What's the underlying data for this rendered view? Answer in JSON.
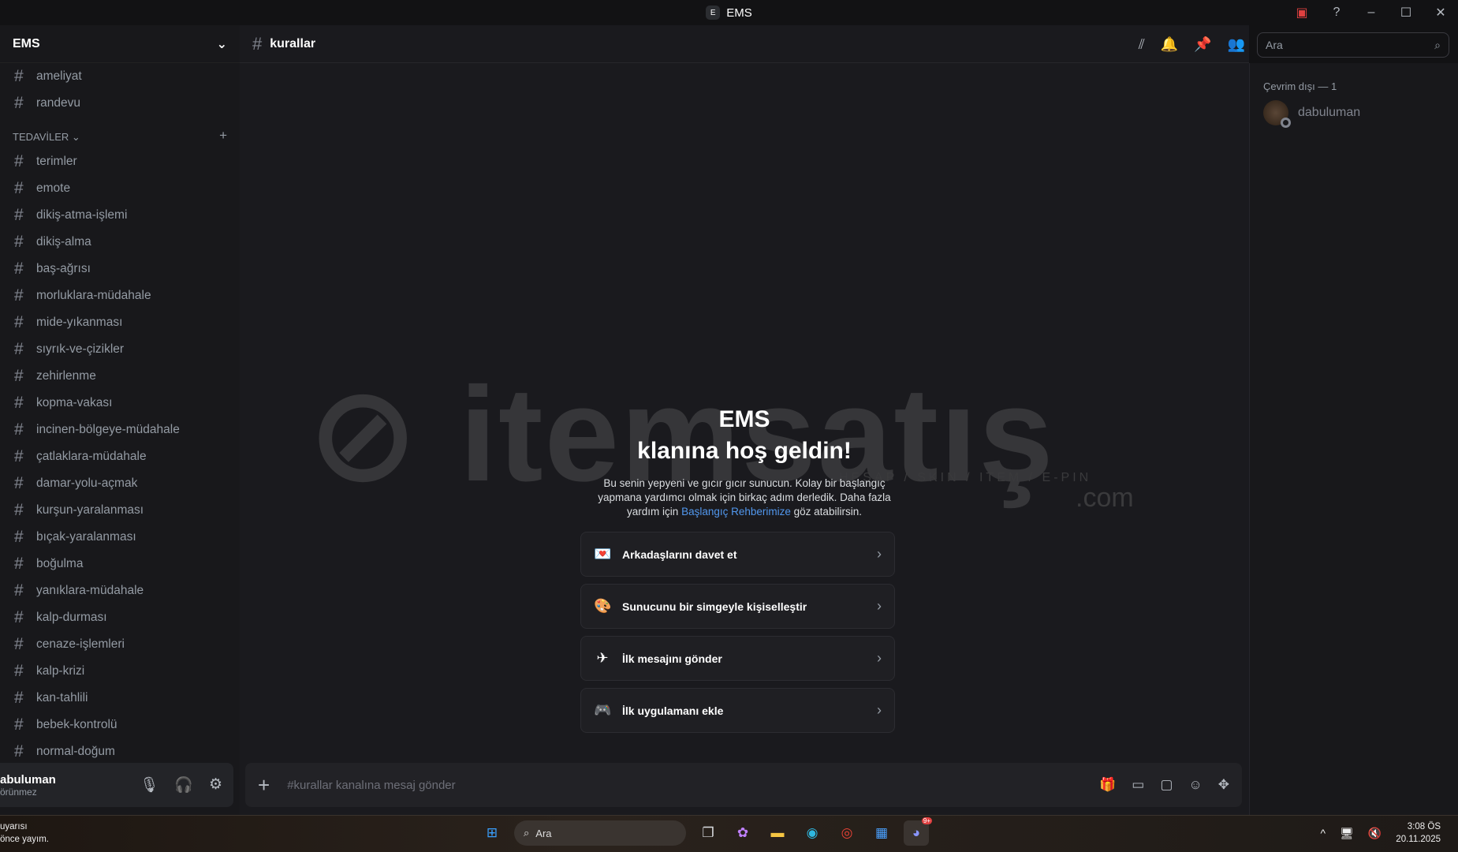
{
  "window": {
    "title": "EMS",
    "server_icon": "E"
  },
  "server": {
    "name": "EMS"
  },
  "sidebar": {
    "top_channels": [
      "ameliyat",
      "randevu"
    ],
    "category": "TEDAVİLER",
    "channels": [
      "terimler",
      "emote",
      "dikiş-atma-işlemi",
      "dikiş-alma",
      "baş-ağrısı",
      "morluklara-müdahale",
      "mide-yıkanması",
      "sıyrık-ve-çizikler",
      "zehirlenme",
      "kopma-vakası",
      "incinen-bölgeye-müdahale",
      "çatlaklara-müdahale",
      "damar-yolu-açmak",
      "kurşun-yaralanması",
      "bıçak-yaralanması",
      "boğulma",
      "yanıklara-müdahale",
      "kalp-durması",
      "cenaze-işlemleri",
      "kalp-krizi",
      "kan-tahlili",
      "bebek-kontrolü",
      "normal-doğum"
    ]
  },
  "user": {
    "name": "abuluman",
    "status": "örünmez"
  },
  "channel": {
    "name": "kurallar"
  },
  "search": {
    "placeholder": "Ara"
  },
  "members": {
    "header": "Çevrim dışı — 1",
    "list": [
      {
        "name": "dabuluman"
      }
    ]
  },
  "welcome": {
    "title1": "EMS",
    "title2": "klanına hoş geldin!",
    "desc1": "Bu senin yepyeni ve gıcır gıcır sunucun. Kolay bir başlangıç yapmana yardımcı olmak için birkaç adım derledik. Daha fazla yardım için ",
    "link": "Başlangıç Rehberimize",
    "desc2": " göz atabilirsin.",
    "cards": [
      "Arkadaşlarını davet et",
      "Sunucunu bir simgeyle kişiselleştir",
      "İlk mesajını gönder",
      "İlk uygulamanı ekle"
    ]
  },
  "watermark": {
    "brand": "itemsatış",
    "tld": ".com",
    "sub": "HESAP / SKIN / ITEM / E-PIN"
  },
  "composer": {
    "placeholder": "#kurallar kanalına mesaj gönder"
  },
  "taskbar": {
    "notif_line1": "uyarısı",
    "notif_line2": "önce yayım.",
    "search": "Ara",
    "time": "3:08 ÖS",
    "date": "20.11.2025",
    "badge": "9+"
  }
}
